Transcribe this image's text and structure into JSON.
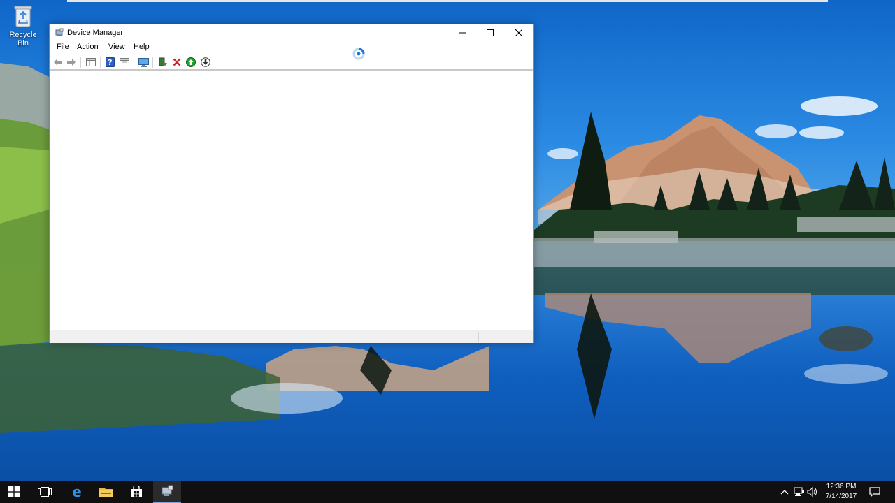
{
  "desktop": {
    "icons": [
      {
        "label": "Recycle Bin",
        "icon": "recycle-bin-icon"
      }
    ]
  },
  "window": {
    "title": "Device Manager",
    "app_icon": "device-manager-icon",
    "caption_buttons": [
      "minimize-icon",
      "maximize-icon",
      "close-icon"
    ],
    "menu": [
      {
        "label": "File"
      },
      {
        "label": "Action"
      },
      {
        "label": "View"
      },
      {
        "label": "Help"
      }
    ],
    "toolbar": [
      "back-arrow-icon",
      "forward-arrow-icon",
      "show-hide-console-tree-icon",
      "help-icon",
      "properties-icon",
      "scan-hardware-icon",
      "update-driver-icon",
      "uninstall-device-icon",
      "enable-device-icon",
      "disable-device-icon"
    ]
  },
  "taskbar": {
    "apps": [
      "start-icon",
      "task-view-icon",
      "edge-icon",
      "file-explorer-icon",
      "store-icon",
      "device-manager-icon"
    ],
    "tray": [
      "show-hidden-icons-chevron",
      "network-icon",
      "volume-icon",
      "action-center-icon"
    ],
    "clock": {
      "time": "12:36 PM",
      "date": "7/14/2017"
    }
  },
  "colors": {
    "accent": "#0078d7",
    "taskbar": "#101010",
    "window_border": "#5e8fc9"
  }
}
